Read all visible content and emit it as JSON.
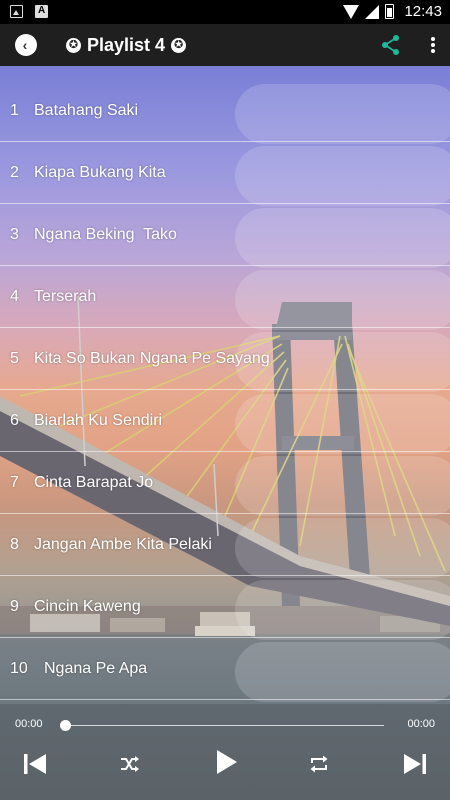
{
  "status_bar": {
    "time": "12:43",
    "left_icons": [
      "image-icon",
      "app-a-icon"
    ],
    "right_icons": [
      "wifi-icon",
      "cellular-icon",
      "battery-icon"
    ]
  },
  "app_bar": {
    "title": "Playlist 4",
    "title_badge_symbol": "✪",
    "actions": [
      "share-icon",
      "more-vert-icon"
    ],
    "accent_color": "#1fb89a"
  },
  "playlist": {
    "tracks": [
      {
        "number": "1",
        "title": "Batahang Saki"
      },
      {
        "number": "2",
        "title": "Kiapa Bukang Kita"
      },
      {
        "number": "3",
        "title": "Ngana Beking  Tako"
      },
      {
        "number": "4",
        "title": "Terserah"
      },
      {
        "number": "5",
        "title": "Kita So Bukan Ngana Pe Sayang"
      },
      {
        "number": "6",
        "title": "Biarlah Ku Sendiri"
      },
      {
        "number": "7",
        "title": "Cinta Barapat Jo"
      },
      {
        "number": "8",
        "title": "Jangan Ambe Kita Pelaki"
      },
      {
        "number": "9",
        "title": "Cincin Kaweng"
      },
      {
        "number": "10",
        "title": "Ngana Pe Apa"
      }
    ]
  },
  "player": {
    "current_time": "00:00",
    "total_time": "00:00",
    "progress": 0,
    "controls": [
      "skip-previous-icon",
      "shuffle-icon",
      "play-icon",
      "repeat-icon",
      "skip-next-icon"
    ]
  }
}
